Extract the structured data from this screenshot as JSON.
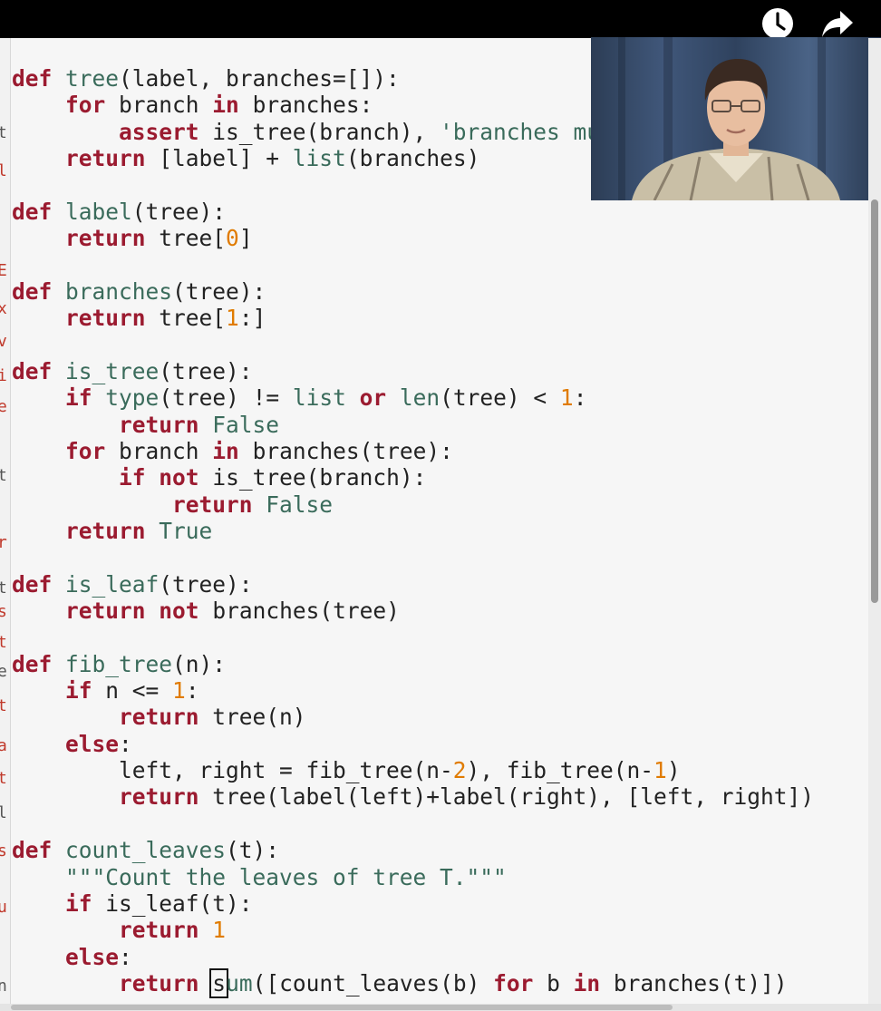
{
  "code_lines": [
    [
      {
        "t": "def",
        "c": "kw"
      },
      {
        "t": " "
      },
      {
        "t": "tree",
        "c": "fn"
      },
      {
        "t": "(label, branches=[]):"
      }
    ],
    [
      {
        "t": "    "
      },
      {
        "t": "for",
        "c": "kw"
      },
      {
        "t": " branch "
      },
      {
        "t": "in",
        "c": "kw"
      },
      {
        "t": " branches:"
      }
    ],
    [
      {
        "t": "        "
      },
      {
        "t": "assert",
        "c": "kw"
      },
      {
        "t": " is_tree(branch), "
      },
      {
        "t": "'branches must be trees'",
        "c": "str"
      }
    ],
    [
      {
        "t": "    "
      },
      {
        "t": "return",
        "c": "kw"
      },
      {
        "t": " [label] + "
      },
      {
        "t": "list",
        "c": "fn"
      },
      {
        "t": "(branches)"
      }
    ],
    [],
    [
      {
        "t": "def",
        "c": "kw"
      },
      {
        "t": " "
      },
      {
        "t": "label",
        "c": "fn"
      },
      {
        "t": "(tree):"
      }
    ],
    [
      {
        "t": "    "
      },
      {
        "t": "return",
        "c": "kw"
      },
      {
        "t": " tree["
      },
      {
        "t": "0",
        "c": "num"
      },
      {
        "t": "]"
      }
    ],
    [],
    [
      {
        "t": "def",
        "c": "kw"
      },
      {
        "t": " "
      },
      {
        "t": "branches",
        "c": "fn"
      },
      {
        "t": "(tree):"
      }
    ],
    [
      {
        "t": "    "
      },
      {
        "t": "return",
        "c": "kw"
      },
      {
        "t": " tree["
      },
      {
        "t": "1",
        "c": "num"
      },
      {
        "t": ":]"
      }
    ],
    [],
    [
      {
        "t": "def",
        "c": "kw"
      },
      {
        "t": " "
      },
      {
        "t": "is_tree",
        "c": "fn"
      },
      {
        "t": "(tree):"
      }
    ],
    [
      {
        "t": "    "
      },
      {
        "t": "if",
        "c": "kw"
      },
      {
        "t": " "
      },
      {
        "t": "type",
        "c": "fn"
      },
      {
        "t": "(tree) != "
      },
      {
        "t": "list",
        "c": "fn"
      },
      {
        "t": " "
      },
      {
        "t": "or",
        "c": "kw"
      },
      {
        "t": " "
      },
      {
        "t": "len",
        "c": "fn"
      },
      {
        "t": "(tree) < "
      },
      {
        "t": "1",
        "c": "num"
      },
      {
        "t": ":"
      }
    ],
    [
      {
        "t": "        "
      },
      {
        "t": "return",
        "c": "kw"
      },
      {
        "t": " "
      },
      {
        "t": "False",
        "c": "str"
      }
    ],
    [
      {
        "t": "    "
      },
      {
        "t": "for",
        "c": "kw"
      },
      {
        "t": " branch "
      },
      {
        "t": "in",
        "c": "kw"
      },
      {
        "t": " branches(tree):"
      }
    ],
    [
      {
        "t": "        "
      },
      {
        "t": "if",
        "c": "kw"
      },
      {
        "t": " "
      },
      {
        "t": "not",
        "c": "kw"
      },
      {
        "t": " is_tree(branch):"
      }
    ],
    [
      {
        "t": "            "
      },
      {
        "t": "return",
        "c": "kw"
      },
      {
        "t": " "
      },
      {
        "t": "False",
        "c": "str"
      }
    ],
    [
      {
        "t": "    "
      },
      {
        "t": "return",
        "c": "kw"
      },
      {
        "t": " "
      },
      {
        "t": "True",
        "c": "str"
      }
    ],
    [],
    [
      {
        "t": "def",
        "c": "kw"
      },
      {
        "t": " "
      },
      {
        "t": "is_leaf",
        "c": "fn"
      },
      {
        "t": "(tree):"
      }
    ],
    [
      {
        "t": "    "
      },
      {
        "t": "return",
        "c": "kw"
      },
      {
        "t": " "
      },
      {
        "t": "not",
        "c": "kw"
      },
      {
        "t": " branches(tree)"
      }
    ],
    [],
    [
      {
        "t": "def",
        "c": "kw"
      },
      {
        "t": " "
      },
      {
        "t": "fib_tree",
        "c": "fn"
      },
      {
        "t": "(n):"
      }
    ],
    [
      {
        "t": "    "
      },
      {
        "t": "if",
        "c": "kw"
      },
      {
        "t": " n <= "
      },
      {
        "t": "1",
        "c": "num"
      },
      {
        "t": ":"
      }
    ],
    [
      {
        "t": "        "
      },
      {
        "t": "return",
        "c": "kw"
      },
      {
        "t": " tree(n)"
      }
    ],
    [
      {
        "t": "    "
      },
      {
        "t": "else",
        "c": "kw"
      },
      {
        "t": ":"
      }
    ],
    [
      {
        "t": "        left, right = fib_tree(n-"
      },
      {
        "t": "2",
        "c": "num"
      },
      {
        "t": "), fib_tree(n-"
      },
      {
        "t": "1",
        "c": "num"
      },
      {
        "t": ")"
      }
    ],
    [
      {
        "t": "        "
      },
      {
        "t": "return",
        "c": "kw"
      },
      {
        "t": " tree(label(left)+label(right), [left, right])"
      }
    ],
    [],
    [
      {
        "t": "def",
        "c": "kw"
      },
      {
        "t": " "
      },
      {
        "t": "count_leaves",
        "c": "fn"
      },
      {
        "t": "(t):"
      }
    ],
    [
      {
        "t": "    "
      },
      {
        "t": "\"\"\"Count the leaves of tree T.\"\"\"",
        "c": "str"
      }
    ],
    [
      {
        "t": "    "
      },
      {
        "t": "if",
        "c": "kw"
      },
      {
        "t": " is_leaf(t):"
      }
    ],
    [
      {
        "t": "        "
      },
      {
        "t": "return",
        "c": "kw"
      },
      {
        "t": " "
      },
      {
        "t": "1",
        "c": "num"
      }
    ],
    [
      {
        "t": "    "
      },
      {
        "t": "else",
        "c": "kw"
      },
      {
        "t": ":"
      }
    ],
    [
      {
        "t": "        "
      },
      {
        "t": "return",
        "c": "kw"
      },
      {
        "t": " "
      },
      {
        "t": "s",
        "c": "cursor"
      },
      {
        "t": "um",
        "c": "fn"
      },
      {
        "t": "([count_leaves(b) "
      },
      {
        "t": "for",
        "c": "kw"
      },
      {
        "t": " b "
      },
      {
        "t": "in",
        "c": "kw"
      },
      {
        "t": " branches(t)])"
      }
    ]
  ],
  "gutter_marks": [
    {
      "ch": "t",
      "color": "#555555"
    },
    {
      "ch": "l",
      "color": "#c0392b"
    },
    {
      "ch": "E",
      "color": "#c0392b"
    },
    {
      "ch": "x",
      "color": "#c0392b"
    },
    {
      "ch": "v",
      "color": "#c0392b"
    },
    {
      "ch": "i",
      "color": "#c0392b"
    },
    {
      "ch": "e",
      "color": "#c0392b"
    },
    {
      "ch": "t",
      "color": "#555555"
    },
    {
      "ch": "r",
      "color": "#c0392b"
    },
    {
      "ch": "t",
      "color": "#555555"
    },
    {
      "ch": "s",
      "color": "#c0392b"
    },
    {
      "ch": "t",
      "color": "#c0392b"
    },
    {
      "ch": "e",
      "color": "#555555"
    },
    {
      "ch": "t",
      "color": "#c0392b"
    },
    {
      "ch": "a",
      "color": "#c0392b"
    },
    {
      "ch": "t",
      "color": "#c0392b"
    },
    {
      "ch": "l",
      "color": "#555555"
    },
    {
      "ch": "s",
      "color": "#c0392b"
    },
    {
      "ch": "u",
      "color": "#c0392b"
    },
    {
      "ch": "n",
      "color": "#555555"
    }
  ],
  "icons": {
    "watch_later": "clock-icon",
    "share": "share-arrow-icon",
    "webcam": "webcam-presenter"
  },
  "colors": {
    "keyword": "#9b1b30",
    "builtin": "#3a6b5b",
    "number": "#e07b00"
  }
}
